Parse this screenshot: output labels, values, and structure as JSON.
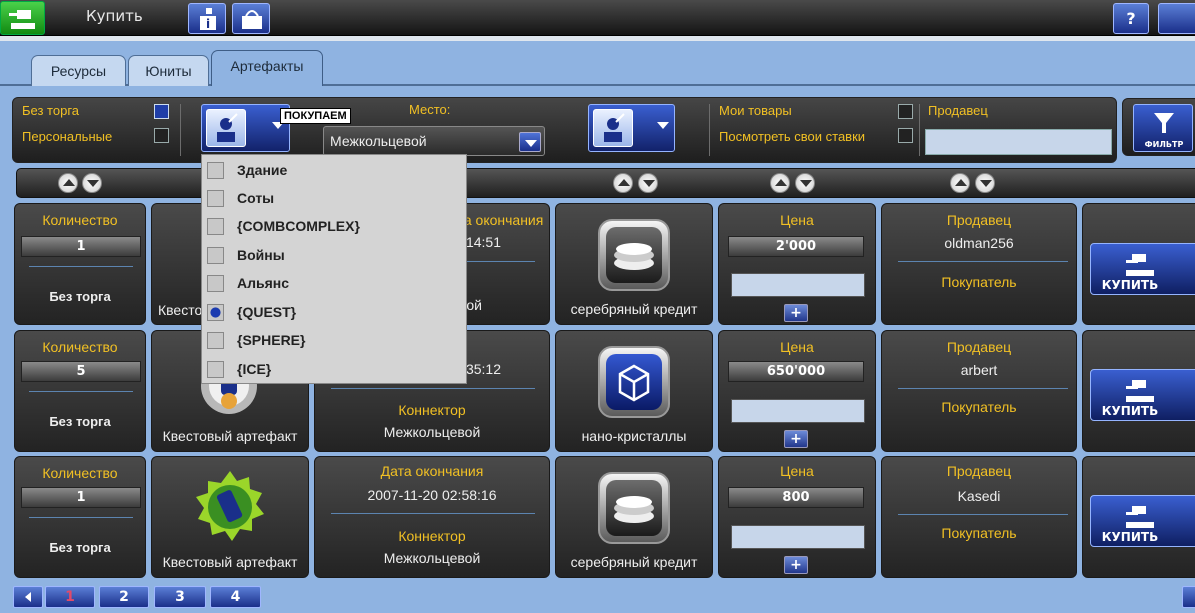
{
  "topbar": {
    "title": "Купить",
    "help_label": "?"
  },
  "tabs": [
    {
      "label": "Ресурсы"
    },
    {
      "label": "Юниты"
    },
    {
      "label": "Артефакты"
    }
  ],
  "filters": {
    "no_bargain_label": "Без торга",
    "personal_label": "Персональные",
    "place_label": "Место:",
    "place_value": "Межкольцевой",
    "tooltip": "ПОКУПАЕМ",
    "my_goods_label": "Мои товары",
    "my_bids_label": "Посмотреть свои ставки",
    "seller_label": "Продавец",
    "filter_button_label": "ФИЛЬТР"
  },
  "dropdown": {
    "items": [
      {
        "label": "Здание",
        "checked": false
      },
      {
        "label": "Соты",
        "checked": false
      },
      {
        "label": "{COMBCOMPLEX}",
        "checked": false
      },
      {
        "label": "Войны",
        "checked": false
      },
      {
        "label": "Альянс",
        "checked": false
      },
      {
        "label": "{QUEST}",
        "checked": true
      },
      {
        "label": "{SPHERE}",
        "checked": false
      },
      {
        "label": "{ICE}",
        "checked": false
      }
    ]
  },
  "labels": {
    "quantity": "Количество",
    "end_date": "Дата окончания",
    "connector": "Коннектор",
    "price": "Цена",
    "seller": "Продавец",
    "buyer": "Покупатель",
    "buy": "КУПИТЬ"
  },
  "rows": [
    {
      "quantity": "1",
      "bargain": "Без торга",
      "artifact": "Квестовый артефакт",
      "artifact_visible": "Квестов",
      "end_date": "",
      "time_fragment": "14:51",
      "connector_fragment": "ой",
      "resource": "серебряный кредит",
      "price": "2'000",
      "seller": "oldman256"
    },
    {
      "quantity": "5",
      "bargain": "Без торга",
      "artifact": "Квестовый артефакт",
      "end_date_fragment": "35:12",
      "connector": "Межкольцевой",
      "resource": "нано-кристаллы",
      "price": "650'000",
      "seller": "arbert"
    },
    {
      "quantity": "1",
      "bargain": "Без торга",
      "artifact": "Квестовый артефакт",
      "end_date": "2007-11-20 02:58:16",
      "connector": "Межкольцевой",
      "resource": "серебряный кредит",
      "price": "800",
      "seller": "Kasedi"
    }
  ],
  "pager": {
    "pages": [
      "1",
      "2",
      "3",
      "4"
    ],
    "current": "1"
  },
  "colors": {
    "accent_yellow": "#f1c024",
    "background": "#8fb3e1",
    "button_blue": "#1a2f8a"
  }
}
